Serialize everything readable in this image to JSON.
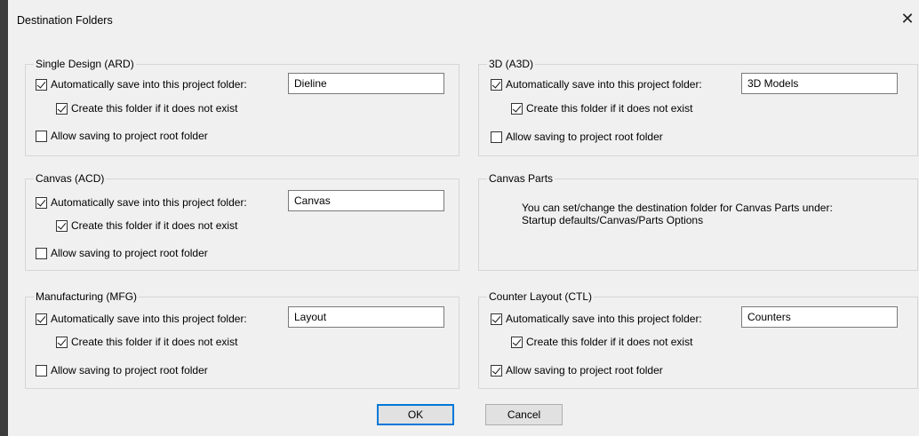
{
  "dialog": {
    "title": "Destination Folders",
    "close_glyph": "✕"
  },
  "groups": {
    "ard": {
      "title": "Single Design (ARD)",
      "auto_save_label": "Automatically save into this project folder:",
      "create_label": "Create this folder if it does not exist",
      "root_label": "Allow saving to project root folder",
      "folder": "Dieline",
      "auto_save": true,
      "create": true,
      "root": false
    },
    "a3d": {
      "title": "3D  (A3D)",
      "auto_save_label": "Automatically save into this project folder:",
      "create_label": "Create this folder if it does not exist",
      "root_label": "Allow saving to project root folder",
      "folder": "3D Models",
      "auto_save": true,
      "create": true,
      "root": false
    },
    "acd": {
      "title": "Canvas (ACD)",
      "auto_save_label": "Automatically save into this project folder:",
      "create_label": "Create this folder if it does not exist",
      "root_label": "Allow saving to project root folder",
      "folder": "Canvas",
      "auto_save": true,
      "create": true,
      "root": false
    },
    "parts": {
      "title": "Canvas Parts",
      "info_line1": "You can set/change the destination folder for Canvas Parts under:",
      "info_line2": "Startup defaults/Canvas/Parts Options"
    },
    "mfg": {
      "title": "Manufacturing (MFG)",
      "auto_save_label": "Automatically save into this project folder:",
      "create_label": "Create this folder if it does not exist",
      "root_label": "Allow saving to project root folder",
      "folder": "Layout",
      "auto_save": true,
      "create": true,
      "root": false
    },
    "ctl": {
      "title": "Counter Layout (CTL)",
      "auto_save_label": "Automatically save into this project folder:",
      "create_label": "Create this folder if it does not exist",
      "root_label": "Allow saving to project root folder",
      "folder": "Counters",
      "auto_save": true,
      "create": true,
      "root": true
    }
  },
  "buttons": {
    "ok": "OK",
    "cancel": "Cancel"
  }
}
